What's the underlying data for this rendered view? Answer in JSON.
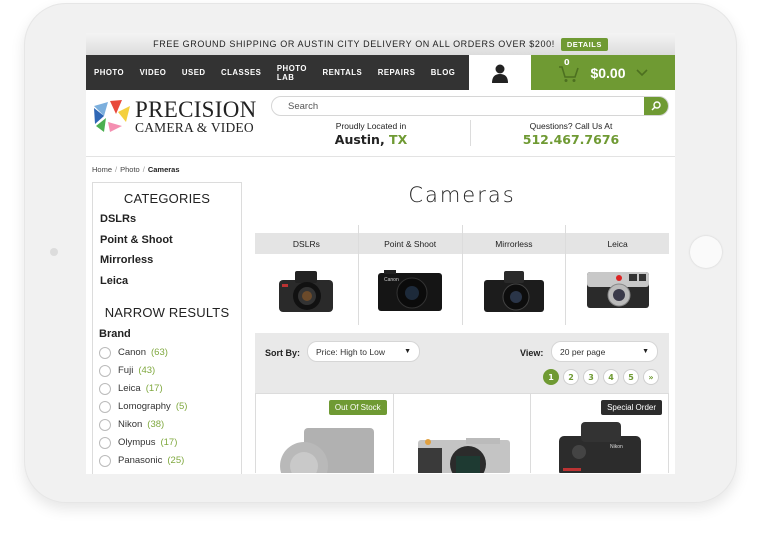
{
  "promo": {
    "text": "FREE GROUND SHIPPING OR AUSTIN CITY DELIVERY ON ALL ORDERS OVER $200!",
    "details_label": "DETAILS"
  },
  "nav": {
    "items": [
      "PHOTO",
      "VIDEO",
      "USED",
      "CLASSES",
      "PHOTO LAB",
      "RENTALS",
      "REPAIRS",
      "BLOG"
    ],
    "account_icon": "user-icon",
    "cart": {
      "count": "0",
      "amount": "$0.00",
      "icon": "cart-icon"
    }
  },
  "header": {
    "logo": {
      "line1": "PRECISION",
      "line2": "CAMERA & VIDEO"
    },
    "search": {
      "placeholder": "Search",
      "value": ""
    },
    "location": {
      "line1": "Proudly Located in",
      "city": "Austin,",
      "state": "TX"
    },
    "contact": {
      "line1": "Questions? Call Us At",
      "phone": "512.467.7676"
    }
  },
  "breadcrumb": [
    "Home",
    "Photo",
    "Cameras"
  ],
  "sidebar": {
    "categories_title": "CATEGORIES",
    "categories": [
      "DSLRs",
      "Point & Shoot",
      "Mirrorless",
      "Leica"
    ],
    "narrow_title": "NARROW RESULTS",
    "brand_title": "Brand",
    "brands": [
      {
        "name": "Canon",
        "count": "(63)"
      },
      {
        "name": "Fuji",
        "count": "(43)"
      },
      {
        "name": "Leica",
        "count": "(17)"
      },
      {
        "name": "Lomography",
        "count": "(5)"
      },
      {
        "name": "Nikon",
        "count": "(38)"
      },
      {
        "name": "Olympus",
        "count": "(17)"
      },
      {
        "name": "Panasonic",
        "count": "(25)"
      }
    ]
  },
  "main": {
    "title": "Cameras",
    "tiles": [
      "DSLRs",
      "Point & Shoot",
      "Mirrorless",
      "Leica"
    ],
    "toolbar": {
      "sort_label": "Sort By:",
      "sort_value": "Price: High to Low",
      "view_label": "View:",
      "view_value": "20 per page",
      "pages": [
        "1",
        "2",
        "3",
        "4",
        "5",
        "»"
      ],
      "active_page": "1"
    },
    "products": [
      {
        "badge": "Out Of Stock"
      },
      {
        "badge": ""
      },
      {
        "badge": "Special Order"
      }
    ]
  },
  "colors": {
    "accent": "#6f9a33",
    "nav_bg": "#333333",
    "badge_dark": "#2c2c2c"
  }
}
